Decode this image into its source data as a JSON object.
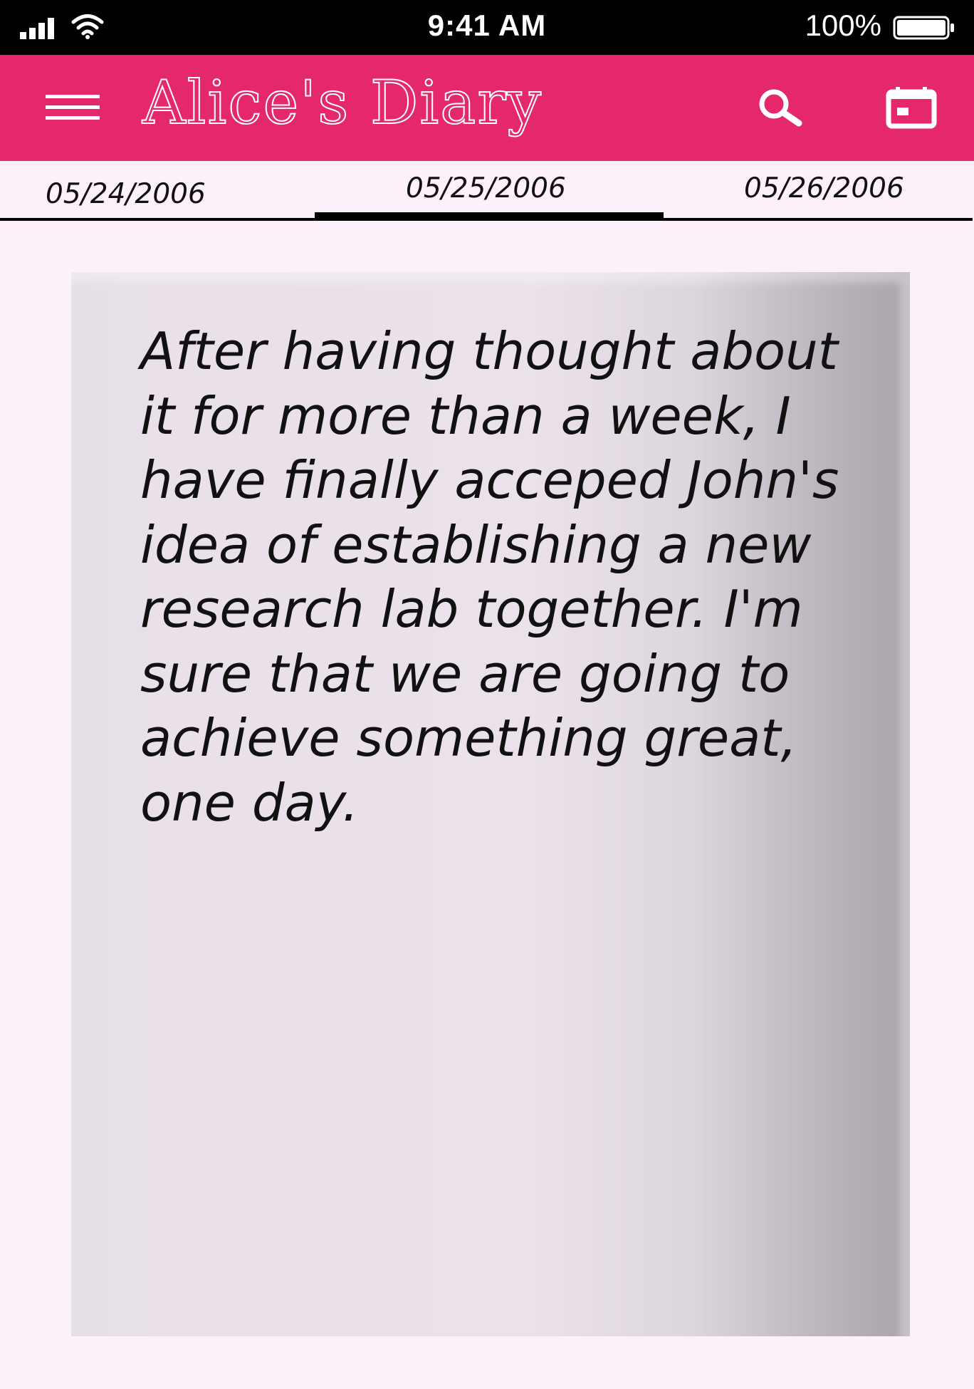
{
  "status_bar": {
    "time": "9:41 AM",
    "battery_percent": "100%",
    "signal_icon": "cellular-signal-icon",
    "wifi_icon": "wifi-icon",
    "battery_icon": "battery-full-icon"
  },
  "app_bar": {
    "title": "Alice's Diary",
    "menu_icon": "hamburger-menu-icon",
    "search_icon": "search-icon",
    "calendar_icon": "calendar-icon",
    "background_color": "#e4286b"
  },
  "date_tabs": {
    "previous": "05/24/2006",
    "current": "05/25/2006",
    "next": "05/26/2006",
    "selected": "05/25/2006"
  },
  "entry": {
    "lines": [
      "After having thought about",
      "it for more than a week, I",
      "have finally acceped John's",
      "idea of establishing a new",
      "research lab together. I'm",
      "sure that we are going to",
      "achieve something great,",
      "one day."
    ]
  },
  "colors": {
    "page_background": "#fcf0fb",
    "accent": "#e4286b",
    "text": "#111111"
  }
}
